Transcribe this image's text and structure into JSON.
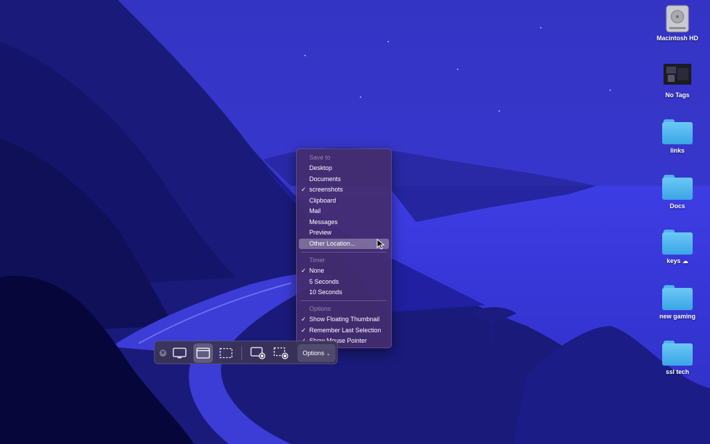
{
  "desktop_icons": [
    {
      "label": "Macintosh HD",
      "icon": "hard-drive-icon"
    },
    {
      "label": "No Tags",
      "icon": "image-thumbnail-icon"
    },
    {
      "label": "links",
      "icon": "folder-icon"
    },
    {
      "label": "Docs",
      "icon": "folder-icon"
    },
    {
      "label": "keys",
      "icon": "folder-icon",
      "badge": "☁"
    },
    {
      "label": "new gaming",
      "icon": "folder-icon"
    },
    {
      "label": "ssl tech",
      "icon": "folder-icon"
    }
  ],
  "toolbar": {
    "close": "✕",
    "buttons": [
      {
        "name": "capture-entire-screen",
        "icon": "screen-icon"
      },
      {
        "name": "capture-selected-window",
        "icon": "window-icon",
        "selected": true
      },
      {
        "name": "capture-selected-portion",
        "icon": "dashed-rect-icon"
      },
      {
        "name": "record-entire-screen",
        "icon": "screen-record-icon"
      },
      {
        "name": "record-selected-portion",
        "icon": "portion-record-icon"
      }
    ],
    "options_label": "Options",
    "options_chevron": "⌄"
  },
  "menu": {
    "save_to_header": "Save to",
    "save_to": [
      {
        "label": "Desktop",
        "checked": false
      },
      {
        "label": "Documents",
        "checked": false
      },
      {
        "label": "screenshots",
        "checked": true
      },
      {
        "label": "Clipboard",
        "checked": false
      },
      {
        "label": "Mail",
        "checked": false
      },
      {
        "label": "Messages",
        "checked": false
      },
      {
        "label": "Preview",
        "checked": false
      },
      {
        "label": "Other Location...",
        "checked": false,
        "highlighted": true
      }
    ],
    "timer_header": "Timer",
    "timer": [
      {
        "label": "None",
        "checked": true
      },
      {
        "label": "5 Seconds",
        "checked": false
      },
      {
        "label": "10 Seconds",
        "checked": false
      }
    ],
    "options_header": "Options",
    "options": [
      {
        "label": "Show Floating Thumbnail",
        "checked": true
      },
      {
        "label": "Remember Last Selection",
        "checked": true
      },
      {
        "label": "Show Mouse Pointer",
        "checked": true
      }
    ],
    "check_glyph": "✓"
  },
  "colors": {
    "sky": "#2f2fc8",
    "sea": "#3b3be6",
    "cliffs_dark": "#0c0c4a",
    "folder": "#4fb3ee",
    "menu_bg": "#442c6e"
  }
}
